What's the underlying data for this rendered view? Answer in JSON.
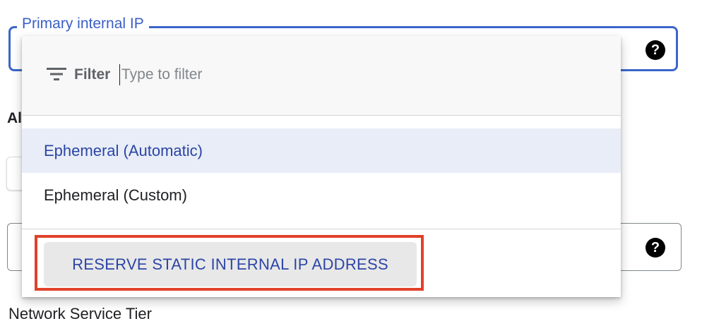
{
  "form": {
    "primary_ip_label": "Primary internal IP",
    "section_label_peek": "Al",
    "network_tier_label": "Network Service Tier",
    "help_icon_glyph": "?"
  },
  "dropdown": {
    "filter_label": "Filter",
    "filter_placeholder": "Type to filter",
    "filter_value": "",
    "options": [
      {
        "label": "Ephemeral (Automatic)",
        "selected": true
      },
      {
        "label": "Ephemeral (Custom)",
        "selected": false
      }
    ],
    "reserve_button_label": "RESERVE STATIC INTERNAL IP ADDRESS"
  },
  "icons": {
    "filter": "filter-lines-icon",
    "help": "question-circle-icon"
  },
  "colors": {
    "accent_blue": "#3b66c9",
    "selected_text": "#2c45a6",
    "selected_bg": "#e8edf7",
    "highlight_red": "#e0412a"
  }
}
